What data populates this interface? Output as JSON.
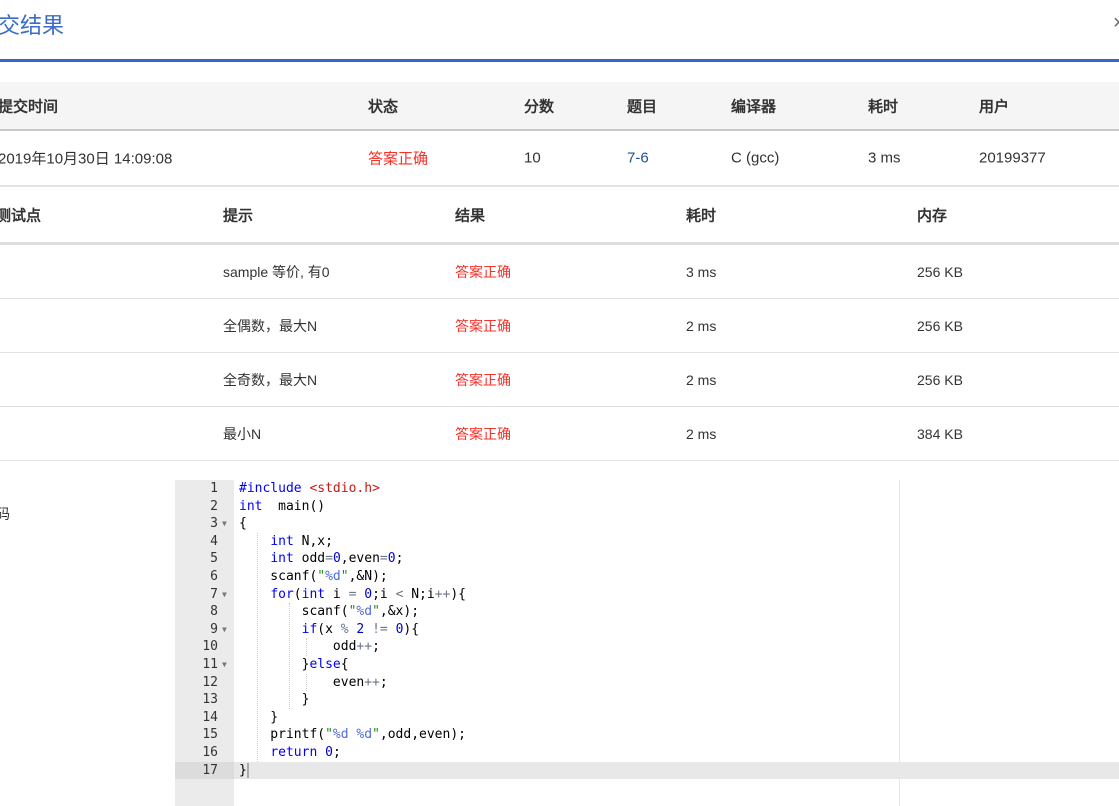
{
  "page": {
    "title": "交结果",
    "close_icon": "×",
    "code_label": "码"
  },
  "submission": {
    "headers": [
      "提交时间",
      "状态",
      "分数",
      "题目",
      "编译器",
      "耗时",
      "用户"
    ],
    "row": [
      "2019年10月30日 14:09:08",
      "答案正确",
      "10",
      "7-6",
      "C (gcc)",
      "3 ms",
      "20199377"
    ]
  },
  "tests": {
    "headers": [
      "测试点",
      "提示",
      "结果",
      "耗时",
      "内存"
    ],
    "rows": [
      [
        "",
        "sample 等价, 有0",
        "答案正确",
        "3 ms",
        "256 KB"
      ],
      [
        "",
        "全偶数，最大N",
        "答案正确",
        "2 ms",
        "256 KB"
      ],
      [
        "",
        "全奇数，最大N",
        "答案正确",
        "2 ms",
        "256 KB"
      ],
      [
        "",
        "最小N",
        "答案正确",
        "2 ms",
        "384 KB"
      ]
    ]
  },
  "code": {
    "active_line": 17,
    "fold_lines": [
      3,
      7,
      9,
      11
    ],
    "lines": [
      [
        [
          "kw",
          "#include "
        ],
        [
          "inc",
          "<stdio.h>"
        ]
      ],
      [
        [
          "kw",
          "int"
        ],
        [
          "",
          "  main()"
        ]
      ],
      [
        [
          "",
          "{"
        ]
      ],
      [
        [
          "",
          "    "
        ],
        [
          "kw",
          "int"
        ],
        [
          "",
          " N,x;"
        ]
      ],
      [
        [
          "",
          "    "
        ],
        [
          "kw",
          "int"
        ],
        [
          "",
          " odd"
        ],
        [
          "op",
          "="
        ],
        [
          "num",
          "0"
        ],
        [
          "",
          ",even"
        ],
        [
          "op",
          "="
        ],
        [
          "num",
          "0"
        ],
        [
          "",
          ";"
        ]
      ],
      [
        [
          "",
          "    scanf("
        ],
        [
          "str",
          "\""
        ],
        [
          "fmt",
          "%d"
        ],
        [
          "str",
          "\""
        ],
        [
          "",
          ",&N);"
        ]
      ],
      [
        [
          "",
          "    "
        ],
        [
          "kw",
          "for"
        ],
        [
          "",
          "("
        ],
        [
          "kw",
          "int"
        ],
        [
          "",
          " i "
        ],
        [
          "op",
          "="
        ],
        [
          "",
          " "
        ],
        [
          "num",
          "0"
        ],
        [
          "",
          ";i "
        ],
        [
          "op",
          "<"
        ],
        [
          "",
          " N;i"
        ],
        [
          "op",
          "++"
        ],
        [
          "",
          "){"
        ]
      ],
      [
        [
          "",
          "        scanf("
        ],
        [
          "str",
          "\""
        ],
        [
          "fmt",
          "%d"
        ],
        [
          "str",
          "\""
        ],
        [
          "",
          ",&x);"
        ]
      ],
      [
        [
          "",
          "        "
        ],
        [
          "kw",
          "if"
        ],
        [
          "",
          "(x "
        ],
        [
          "op",
          "%"
        ],
        [
          "",
          " "
        ],
        [
          "num",
          "2"
        ],
        [
          "",
          " "
        ],
        [
          "op",
          "!="
        ],
        [
          "",
          " "
        ],
        [
          "num",
          "0"
        ],
        [
          "",
          "){"
        ]
      ],
      [
        [
          "",
          "            odd"
        ],
        [
          "op",
          "++"
        ],
        [
          "",
          ";"
        ]
      ],
      [
        [
          "",
          "        }"
        ],
        [
          "kw",
          "else"
        ],
        [
          "",
          "{"
        ]
      ],
      [
        [
          "",
          "            even"
        ],
        [
          "op",
          "++"
        ],
        [
          "",
          ";"
        ]
      ],
      [
        [
          "",
          "        }"
        ]
      ],
      [
        [
          "",
          "    }"
        ]
      ],
      [
        [
          "",
          "    printf("
        ],
        [
          "str",
          "\""
        ],
        [
          "fmt",
          "%d %d"
        ],
        [
          "str",
          "\""
        ],
        [
          "",
          ",odd,even);"
        ]
      ],
      [
        [
          "",
          "    "
        ],
        [
          "kw",
          "return"
        ],
        [
          "",
          " "
        ],
        [
          "num",
          "0"
        ],
        [
          "",
          ";"
        ]
      ],
      [
        [
          "",
          "}"
        ]
      ]
    ]
  }
}
